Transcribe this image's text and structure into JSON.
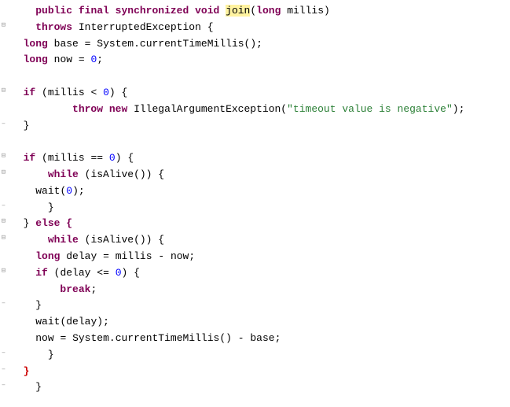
{
  "code": {
    "l1": {
      "kw_public": "public",
      "kw_final": "final",
      "kw_synchronized": "synchronized",
      "kw_void": "void",
      "name": "join",
      "paren_o": "(",
      "type_long": "long",
      "param": "millis",
      "paren_c": ")"
    },
    "l2": {
      "kw_throws": "throws",
      "exc": "InterruptedException",
      "brace": "{"
    },
    "l3": {
      "type_long": "long",
      "var": "base",
      "eq": "=",
      "cls": "System",
      "dot": ".",
      "mth": "currentTimeMillis",
      "paren": "()",
      "semi": ";"
    },
    "l4": {
      "type_long": "long",
      "var": "now",
      "eq": "=",
      "val": "0",
      "semi": ";"
    },
    "l6": {
      "kw_if": "if",
      "po": "(",
      "var": "millis",
      "op": "<",
      "val": "0",
      "pc": ")",
      "brace": "{"
    },
    "l7": {
      "kw_throw": "throw",
      "kw_new": "new",
      "cls": "IllegalArgumentException",
      "po": "(",
      "str": "\"timeout value is negative\"",
      "pc": ")",
      "semi": ";"
    },
    "l8": {
      "brace": "}"
    },
    "l10": {
      "kw_if": "if",
      "po": "(",
      "var": "millis",
      "op": "==",
      "val": "0",
      "pc": ")",
      "brace": "{"
    },
    "l11": {
      "kw_while": "while",
      "po": "(",
      "mth": "isAlive",
      "paren": "()",
      "pc": ")",
      "brace": "{"
    },
    "l12": {
      "mth": "wait",
      "po": "(",
      "val": "0",
      "pc": ")",
      "semi": ";"
    },
    "l13": {
      "brace": "}"
    },
    "l14": {
      "brace": "}",
      "kw_else": "else",
      "brace2": "{"
    },
    "l15": {
      "kw_while": "while",
      "po": "(",
      "mth": "isAlive",
      "paren": "()",
      "pc": ")",
      "brace": "{"
    },
    "l16": {
      "type_long": "long",
      "var": "delay",
      "eq": "=",
      "a": "millis",
      "op": "-",
      "b": "now",
      "semi": ";"
    },
    "l17": {
      "kw_if": "if",
      "po": "(",
      "var": "delay",
      "op": "<=",
      "val": "0",
      "pc": ")",
      "brace": "{"
    },
    "l18": {
      "kw_break": "break",
      "semi": ";"
    },
    "l19": {
      "brace": "}"
    },
    "l20": {
      "mth": "wait",
      "po": "(",
      "arg": "delay",
      "pc": ")",
      "semi": ";"
    },
    "l21": {
      "var": "now",
      "eq": "=",
      "cls": "System",
      "dot": ".",
      "mth": "currentTimeMillis",
      "paren": "()",
      "op": "-",
      "b": "base",
      "semi": ";"
    },
    "l22": {
      "brace": "}"
    },
    "l23": {
      "brace": "}"
    },
    "l24": {
      "brace": "}"
    }
  }
}
